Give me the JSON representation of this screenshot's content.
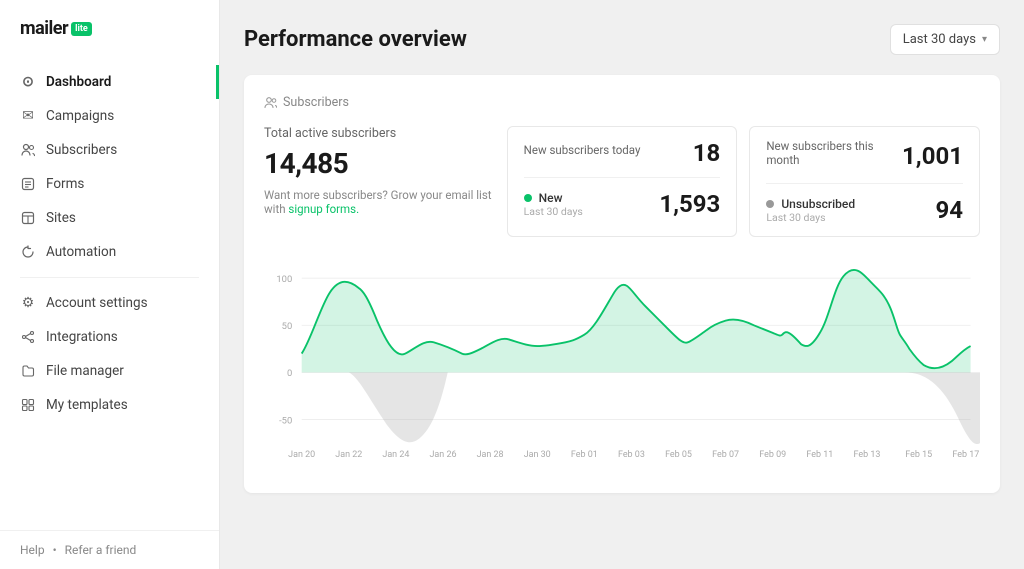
{
  "logo": {
    "text": "mailer",
    "badge": "lite"
  },
  "sidebar": {
    "items": [
      {
        "id": "dashboard",
        "label": "Dashboard",
        "icon": "⊙",
        "active": true
      },
      {
        "id": "campaigns",
        "label": "Campaigns",
        "icon": "✉",
        "active": false
      },
      {
        "id": "subscribers",
        "label": "Subscribers",
        "icon": "👤",
        "active": false
      },
      {
        "id": "forms",
        "label": "Forms",
        "icon": "◈",
        "active": false
      },
      {
        "id": "sites",
        "label": "Sites",
        "icon": "◻",
        "active": false
      },
      {
        "id": "automation",
        "label": "Automation",
        "icon": "↻",
        "active": false
      }
    ],
    "bottom_items": [
      {
        "id": "account-settings",
        "label": "Account settings",
        "icon": "⚙"
      },
      {
        "id": "integrations",
        "label": "Integrations",
        "icon": "🔗"
      },
      {
        "id": "file-manager",
        "label": "File manager",
        "icon": "🗂"
      },
      {
        "id": "my-templates",
        "label": "My templates",
        "icon": "◫"
      }
    ],
    "footer": {
      "help": "Help",
      "separator": "•",
      "refer": "Refer a friend"
    }
  },
  "header": {
    "title": "Performance overview",
    "date_filter": "Last 30 days"
  },
  "section": {
    "subscribers_label": "Subscribers"
  },
  "stats": {
    "total_label": "Total active subscribers",
    "total_value": "14,485",
    "signup_text": "Want more subscribers? Grow your email list with",
    "signup_link": "signup forms.",
    "new_today_label": "New subscribers today",
    "new_today_value": "18",
    "new_month_label": "New subscribers this month",
    "new_month_value": "1,001",
    "new_label": "New",
    "new_sublabel": "Last 30 days",
    "new_value": "1,593",
    "unsub_label": "Unsubscribed",
    "unsub_sublabel": "Last 30 days",
    "unsub_value": "94"
  },
  "chart": {
    "x_labels": [
      "Jan 20",
      "Jan 22",
      "Jan 24",
      "Jan 26",
      "Jan 28",
      "Jan 30",
      "Feb 01",
      "Feb 03",
      "Feb 05",
      "Feb 07",
      "Feb 09",
      "Feb 11",
      "Feb 13",
      "Feb 15",
      "Feb 17"
    ],
    "y_labels": [
      "100",
      "50",
      "0",
      "-50"
    ],
    "accent_color": "#09c269",
    "fill_color": "rgba(9,194,105,0.15)",
    "gray_color": "rgba(180,180,180,0.4)"
  }
}
